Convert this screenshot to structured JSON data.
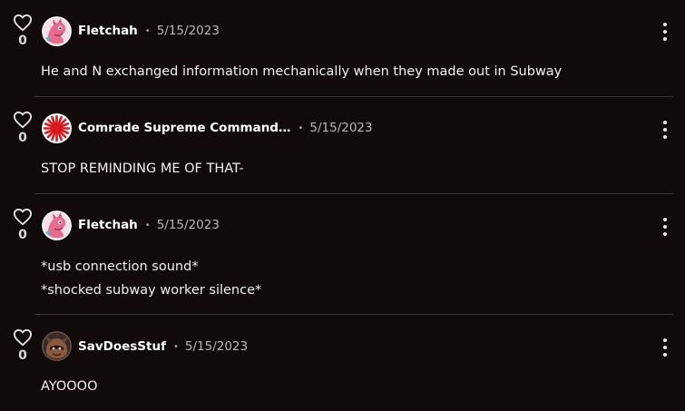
{
  "comments": [
    {
      "username": "Fletchah",
      "date": "5/15/2023",
      "likes": "0",
      "avatar": "pink-dragon-avatar",
      "lines": [
        "He and N exchanged information mechanically when they made out in Subway"
      ]
    },
    {
      "username": "Comrade Supreme Command…",
      "date": "5/15/2023",
      "likes": "0",
      "avatar": "rising-sun-avatar",
      "lines": [
        "STOP REMINDING ME OF THAT-"
      ]
    },
    {
      "username": "Fletchah",
      "date": "5/15/2023",
      "likes": "0",
      "avatar": "pink-dragon-avatar",
      "lines": [
        "*usb connection sound*",
        "*shocked subway worker silence*"
      ]
    },
    {
      "username": "SavDoesStuf",
      "date": "5/15/2023",
      "likes": "0",
      "avatar": "brown-creature-avatar",
      "lines": [
        "AYOOOO"
      ]
    }
  ],
  "separator": "•",
  "icons": {
    "like": "heart-outline-icon",
    "menu": "vertical-dots-icon"
  },
  "colors": {
    "background": "#100a0b",
    "divider": "#3a3435",
    "text": "#f0f0f0",
    "muted": "#bdb6b7"
  }
}
